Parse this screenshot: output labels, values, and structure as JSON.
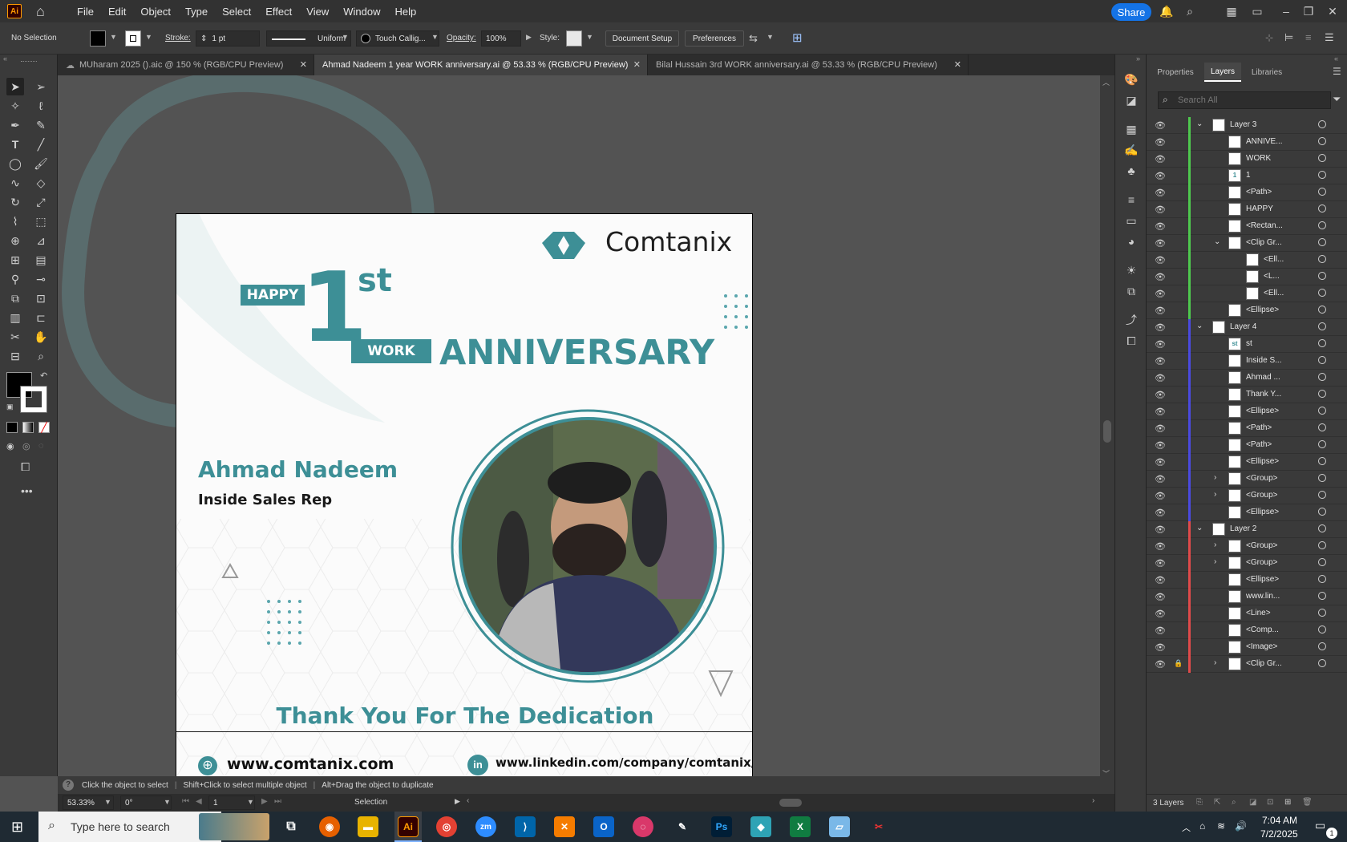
{
  "app": {
    "icon_label": "Ai"
  },
  "menu": [
    "File",
    "Edit",
    "Object",
    "Type",
    "Select",
    "Effect",
    "View",
    "Window",
    "Help"
  ],
  "share_label": "Share",
  "control": {
    "selection": "No Selection",
    "stroke_label": "Stroke:",
    "stroke_value": "1 pt",
    "stroke_profile": "Uniform",
    "brush": "Touch Callig...",
    "opacity_label": "Opacity:",
    "opacity_value": "100%",
    "style_label": "Style:",
    "doc_setup": "Document Setup",
    "preferences": "Preferences"
  },
  "tabs": [
    {
      "label": "MUharam 2025 ().aic @ 150 % (RGB/CPU Preview)"
    },
    {
      "label": "Ahmad Nadeem  1 year WORK anniversary.ai @ 53.33 % (RGB/CPU Preview)"
    },
    {
      "label": "Bilal Hussain  3rd  WORK anniversary.ai @ 53.33 % (RGB/CPU Preview)"
    }
  ],
  "artboard": {
    "logo": "Comtanix",
    "happy": "HAPPY",
    "one": "1",
    "st": "st",
    "work": "WORK",
    "anniversary": "ANNIVERSARY",
    "name": "Ahmad Nadeem",
    "role": "Inside Sales Rep",
    "thank_you": "Thank You For The Dedication",
    "website": "www.comtanix.com",
    "linkedin": "www.linkedin.com/company/comtanix/",
    "accent": "#3d8f96"
  },
  "status": {
    "hint1": "Click the object to select",
    "hint2": "Shift+Click to select multiple object",
    "hint3": "Alt+Drag the object to duplicate",
    "zoom": "53.33%",
    "rotation": "0°",
    "artboard_num": "1",
    "tool": "Selection"
  },
  "panel": {
    "tabs": [
      "Properties",
      "Layers",
      "Libraries"
    ],
    "search_placeholder": "Search All",
    "layers_count": "3 Layers",
    "layers": [
      {
        "name": "Layer 3",
        "level": 0,
        "expanded": true,
        "color": "#4ec94e",
        "thumb": ""
      },
      {
        "name": "ANNIVE...",
        "level": 2,
        "color": "#4ec94e",
        "thumb": ""
      },
      {
        "name": "WORK",
        "level": 2,
        "color": "#4ec94e",
        "thumb": ""
      },
      {
        "name": "1",
        "level": 2,
        "color": "#4ec94e",
        "thumb": "1"
      },
      {
        "name": "<Path>",
        "level": 2,
        "color": "#4ec94e",
        "thumb": ""
      },
      {
        "name": "HAPPY",
        "level": 2,
        "color": "#4ec94e",
        "thumb": ""
      },
      {
        "name": "<Rectan...",
        "level": 2,
        "color": "#4ec94e",
        "thumb": ""
      },
      {
        "name": "<Clip Gr...",
        "level": 1,
        "expanded": true,
        "color": "#4ec94e",
        "thumb": ""
      },
      {
        "name": "<Ell...",
        "level": 3,
        "color": "#4ec94e",
        "thumb": ""
      },
      {
        "name": "<L...",
        "level": 3,
        "color": "#4ec94e",
        "thumb": ""
      },
      {
        "name": "<Ell...",
        "level": 3,
        "color": "#4ec94e",
        "thumb": ""
      },
      {
        "name": "<Ellipse>",
        "level": 2,
        "color": "#4ec94e",
        "thumb": ""
      },
      {
        "name": "Layer 4",
        "level": 0,
        "expanded": true,
        "color": "#4a4ae0",
        "thumb": ""
      },
      {
        "name": "st",
        "level": 2,
        "color": "#4a4ae0",
        "thumb": "st"
      },
      {
        "name": "Inside S...",
        "level": 2,
        "color": "#4a4ae0",
        "thumb": ""
      },
      {
        "name": "Ahmad ...",
        "level": 2,
        "color": "#4a4ae0",
        "thumb": ""
      },
      {
        "name": "Thank Y...",
        "level": 2,
        "color": "#4a4ae0",
        "thumb": ""
      },
      {
        "name": "<Ellipse>",
        "level": 2,
        "color": "#4a4ae0",
        "thumb": ""
      },
      {
        "name": "<Path>",
        "level": 2,
        "color": "#4a4ae0",
        "thumb": ""
      },
      {
        "name": "<Path>",
        "level": 2,
        "color": "#4a4ae0",
        "thumb": ""
      },
      {
        "name": "<Ellipse>",
        "level": 2,
        "color": "#4a4ae0",
        "thumb": ""
      },
      {
        "name": "<Group>",
        "level": 1,
        "collapsed": true,
        "color": "#4a4ae0",
        "thumb": ""
      },
      {
        "name": "<Group>",
        "level": 1,
        "collapsed": true,
        "color": "#4a4ae0",
        "thumb": ""
      },
      {
        "name": "<Ellipse>",
        "level": 2,
        "color": "#4a4ae0",
        "thumb": ""
      },
      {
        "name": "Layer 2",
        "level": 0,
        "expanded": true,
        "color": "#e04a4a",
        "thumb": ""
      },
      {
        "name": "<Group>",
        "level": 1,
        "collapsed": true,
        "color": "#e04a4a",
        "thumb": ""
      },
      {
        "name": "<Group>",
        "level": 1,
        "collapsed": true,
        "color": "#e04a4a",
        "thumb": ""
      },
      {
        "name": "<Ellipse>",
        "level": 2,
        "color": "#e04a4a",
        "thumb": ""
      },
      {
        "name": "www.lin...",
        "level": 2,
        "color": "#e04a4a",
        "thumb": ""
      },
      {
        "name": "<Line>",
        "level": 2,
        "color": "#e04a4a",
        "thumb": ""
      },
      {
        "name": "<Comp...",
        "level": 2,
        "color": "#e04a4a",
        "thumb": ""
      },
      {
        "name": "<Image>",
        "level": 2,
        "color": "#e04a4a",
        "thumb": ""
      },
      {
        "name": "<Clip Gr...",
        "level": 1,
        "collapsed": true,
        "locked": true,
        "color": "#e04a4a",
        "thumb": ""
      }
    ]
  },
  "taskbar": {
    "search_placeholder": "Type here to search",
    "time": "7:04 AM",
    "date": "7/2/2025",
    "notification_count": "1"
  }
}
